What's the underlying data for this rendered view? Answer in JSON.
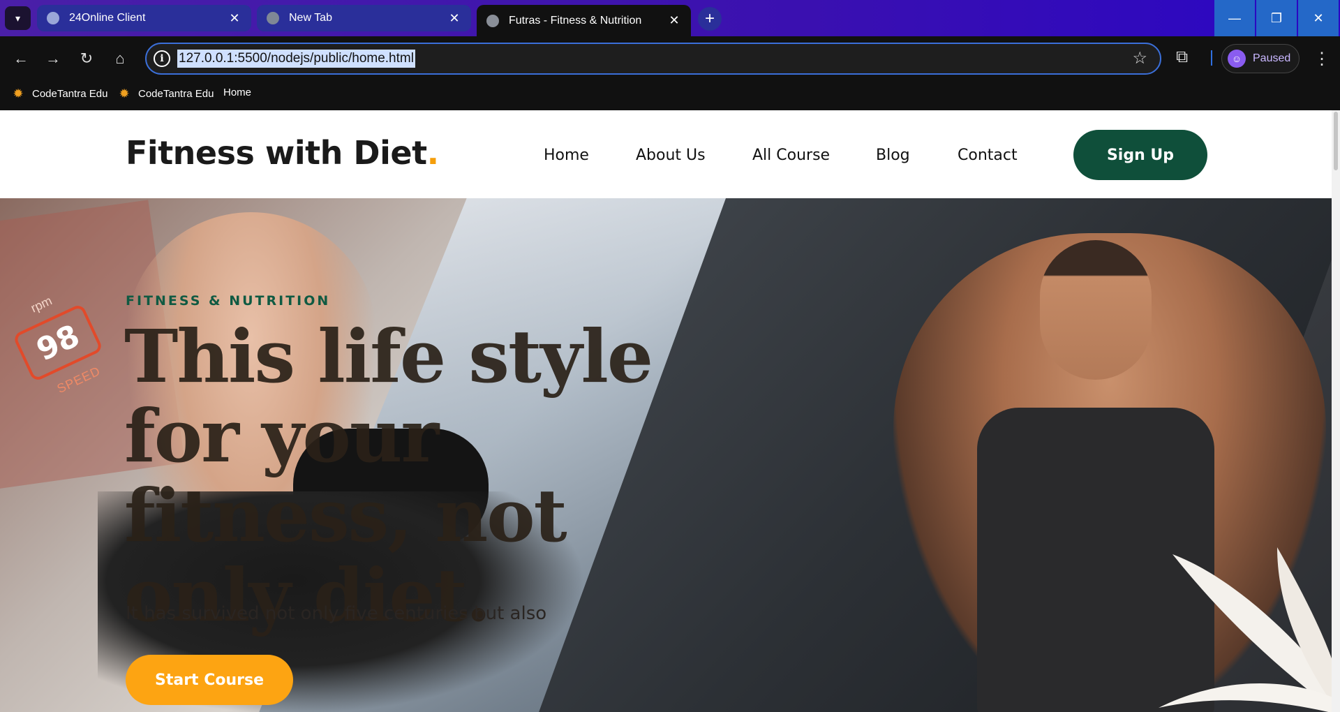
{
  "browser": {
    "tabs": [
      {
        "title": "24Online Client",
        "active": false
      },
      {
        "title": "New Tab",
        "active": false
      },
      {
        "title": "Futras - Fitness & Nutrition",
        "active": true
      }
    ],
    "url": "127.0.0.1:5500/nodejs/public/home.html",
    "profile_status": "Paused",
    "bookmarks": [
      {
        "label": "CodeTantra Edu",
        "icon": "codetantra-icon"
      },
      {
        "label": "CodeTantra Edu",
        "icon": "codetantra-icon"
      },
      {
        "label": "Home",
        "icon": "page-icon"
      }
    ]
  },
  "site": {
    "logo_text": "Fitness with Diet",
    "logo_dot": ".",
    "nav": [
      "Home",
      "About Us",
      "All Course",
      "Blog",
      "Contact"
    ],
    "signup_label": "Sign Up"
  },
  "hero": {
    "eyebrow": "FITNESS & NUTRITION",
    "headline": "This life style for your fitness, not only diet.",
    "subtext": "It has survived not only five centuries but also",
    "cta_label": "Start Course",
    "speed_value": "98",
    "speed_unit": "rpm",
    "speed_label": "SPEED"
  },
  "colors": {
    "brand_green": "#0f4f3a",
    "accent_orange": "#fda412",
    "logo_dot": "#f59e0b"
  }
}
